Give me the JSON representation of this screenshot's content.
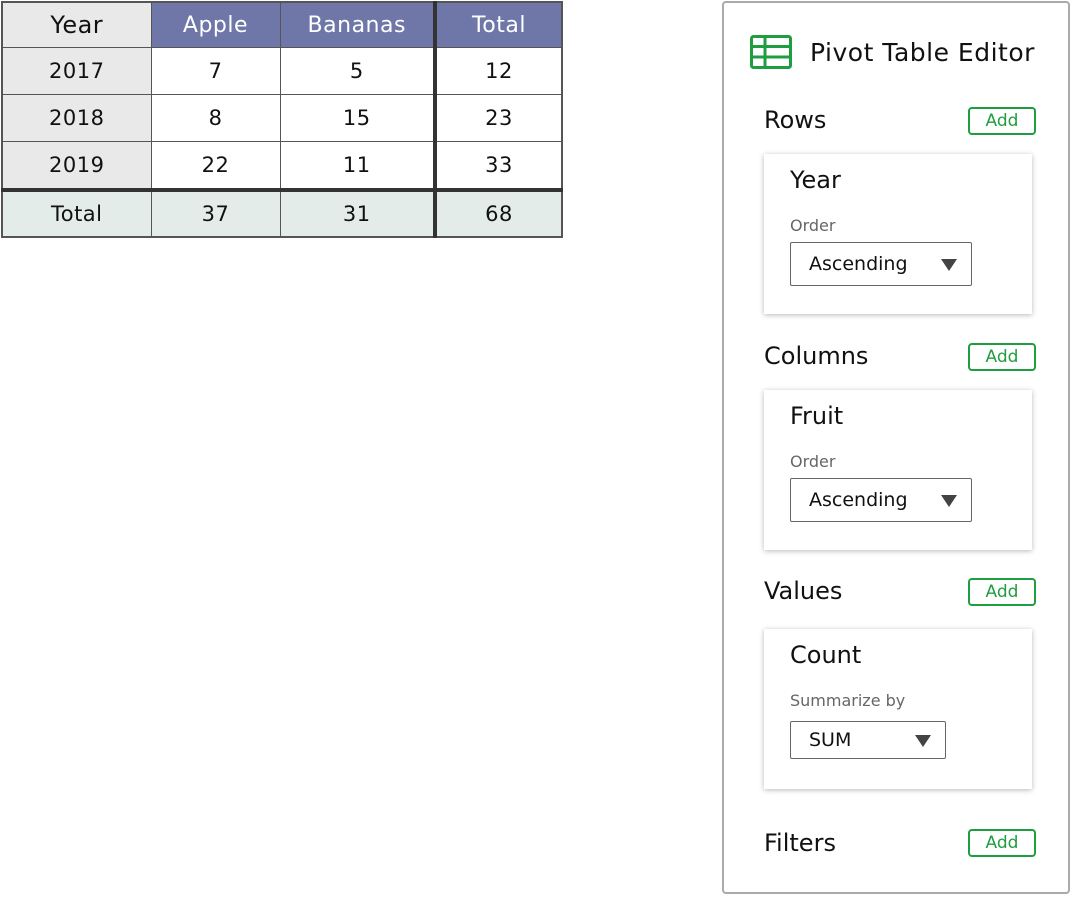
{
  "table": {
    "header": {
      "corner": "Year",
      "columns": [
        "Apple",
        "Bananas",
        "Total"
      ]
    },
    "rows": [
      {
        "label": "2017",
        "values": [
          "7",
          "5",
          "12"
        ]
      },
      {
        "label": "2018",
        "values": [
          "8",
          "15",
          "23"
        ]
      },
      {
        "label": "2019",
        "values": [
          "22",
          "11",
          "33"
        ]
      }
    ],
    "total": {
      "label": "Total",
      "values": [
        "37",
        "31",
        "68"
      ]
    },
    "colors": {
      "header_bg": "#6e77a8",
      "header_text": "#ffffff",
      "rowhead_bg": "#e9e9e9",
      "total_bg": "#e4ecea"
    }
  },
  "editor": {
    "title": "Pivot Table Editor",
    "icon": "spreadsheet-icon",
    "accent_color": "#1e9e3f",
    "add_label": "Add",
    "rows": {
      "label": "Rows",
      "field": "Year",
      "option_label": "Order",
      "selected": "Ascending"
    },
    "columns": {
      "label": "Columns",
      "field": "Fruit",
      "option_label": "Order",
      "selected": "Ascending"
    },
    "values": {
      "label": "Values",
      "field": "Count",
      "option_label": "Summarize by",
      "selected": "SUM"
    },
    "filters": {
      "label": "Filters"
    }
  }
}
